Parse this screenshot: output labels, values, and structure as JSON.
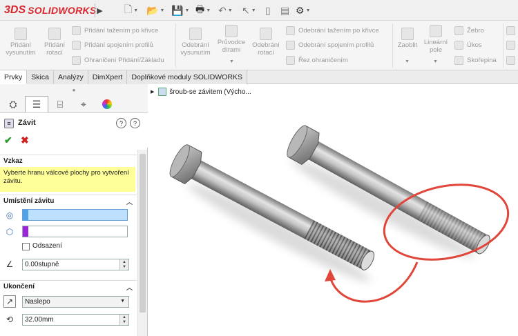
{
  "app": {
    "brand_prefix": "3DS",
    "brand_name": "SOLIDWORKS"
  },
  "ribbon": {
    "features": {
      "extrude_boss": "Přidání vysunutím",
      "revolve_boss": "Přidání rotací",
      "swept_boss": "Přidání tažením po křivce",
      "lofted_boss": "Přidání spojením profilů",
      "boundary_boss": "Ohraničení Přidání/Základu",
      "extrude_cut": "Odebrání vysunutím",
      "hole_wizard": "Průvodce dírami",
      "revolve_cut": "Odebrání rotací",
      "swept_cut": "Odebrání tažením po křivce",
      "lofted_cut": "Odebrání spojením profilů",
      "boundary_cut": "Řez ohraničením",
      "fillet": "Zaoblit",
      "linear_pattern": "Lineární pole",
      "rib": "Žebro",
      "draft": "Úkos",
      "shell": "Skořepina"
    }
  },
  "tabs": [
    "Prvky",
    "Skica",
    "Analýzy",
    "DimXpert",
    "Doplňkové moduly SOLIDWORKS"
  ],
  "property_manager": {
    "title": "Závit",
    "message_head": "Vzkaz",
    "message_text": "Vyberte hranu válcové plochy pro vytvoření závitu.",
    "location_head": "Umístění závitu",
    "edge_value": "",
    "start_value": "",
    "offset_label": "Odsazení",
    "angle_value": "0.00stupně",
    "end_head": "Ukončení",
    "end_type": "Naslepo",
    "depth_value": "32.00mm"
  },
  "tree": {
    "root_label": "šroub-se závitem  (Výcho..."
  },
  "colors": {
    "accent_red": "#d7282f",
    "message_bg": "#ffff99",
    "selection_blue": "#bde0ff",
    "annotation_red": "#e0463a"
  }
}
